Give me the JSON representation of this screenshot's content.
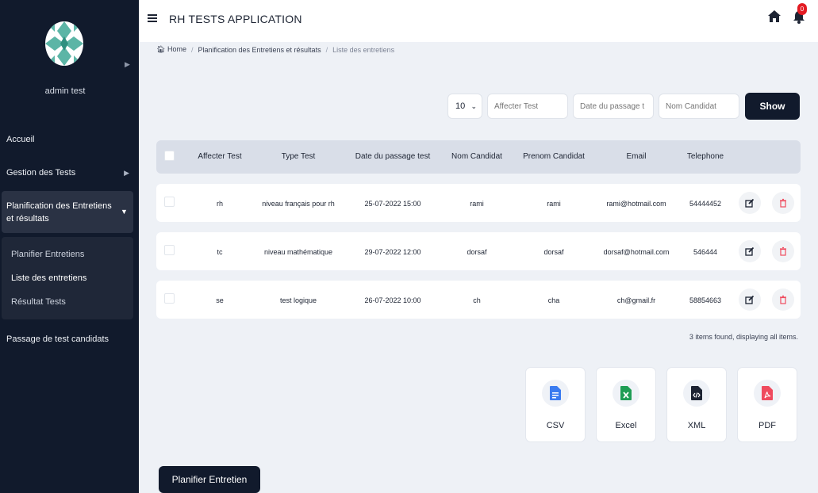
{
  "sidebar": {
    "user_name": "admin test",
    "nav": {
      "accueil": "Accueil",
      "gestion_tests": "Gestion des Tests",
      "planification": "Planification des Entretiens et résultats",
      "passage": "Passage de test candidats"
    },
    "submenu": {
      "planifier": "Planifier Entretiens",
      "liste": "Liste des entretiens",
      "resultat": "Résultat Tests"
    }
  },
  "header": {
    "title": "RH TESTS APPLICATION",
    "notification_count": "0"
  },
  "breadcrumb": {
    "home": "Home",
    "section": "Planification des Entretiens et résultats",
    "current": "Liste des entretiens"
  },
  "filters": {
    "page_size": "10",
    "affecter_test_placeholder": "Affecter Test",
    "date_placeholder": "Date du passage t",
    "nom_placeholder": "Nom Candidat",
    "show_label": "Show"
  },
  "table": {
    "headers": {
      "affecter": "Affecter Test",
      "type": "Type Test",
      "date": "Date du passage test",
      "nom": "Nom Candidat",
      "prenom": "Prenom Candidat",
      "email": "Email",
      "tel": "Telephone"
    },
    "rows": [
      {
        "affecter": "rh",
        "type": "niveau français pour rh",
        "date": "25-07-2022 15:00",
        "nom": "rami",
        "prenom": "rami",
        "email": "rami@hotmail.com",
        "tel": "54444452"
      },
      {
        "affecter": "tc",
        "type": "niveau mathématique",
        "date": "29-07-2022 12:00",
        "nom": "dorsaf",
        "prenom": "dorsaf",
        "email": "dorsaf@hotmail.com",
        "tel": "546444"
      },
      {
        "affecter": "se",
        "type": "test logique",
        "date": "26-07-2022 10:00",
        "nom": "ch",
        "prenom": "cha",
        "email": "ch@gmail.fr",
        "tel": "58854663"
      }
    ],
    "summary": "3 items found, displaying all items."
  },
  "export": {
    "csv": "CSV",
    "excel": "Excel",
    "xml": "XML",
    "pdf": "PDF"
  },
  "actions": {
    "planifier_label": "Planifier Entretien"
  },
  "colors": {
    "sidebar_bg": "#111a2c",
    "csv": "#3a7bf0",
    "excel": "#1f9d55",
    "xml": "#1d2433",
    "pdf": "#ef4a5e",
    "delete": "#ef4a5e",
    "badge": "#e31b23"
  },
  "icons": [
    "menu-icon",
    "home-icon",
    "bell-icon",
    "edit-icon",
    "trash-icon",
    "csv-file-icon",
    "excel-file-icon",
    "xml-file-icon",
    "pdf-file-icon"
  ]
}
